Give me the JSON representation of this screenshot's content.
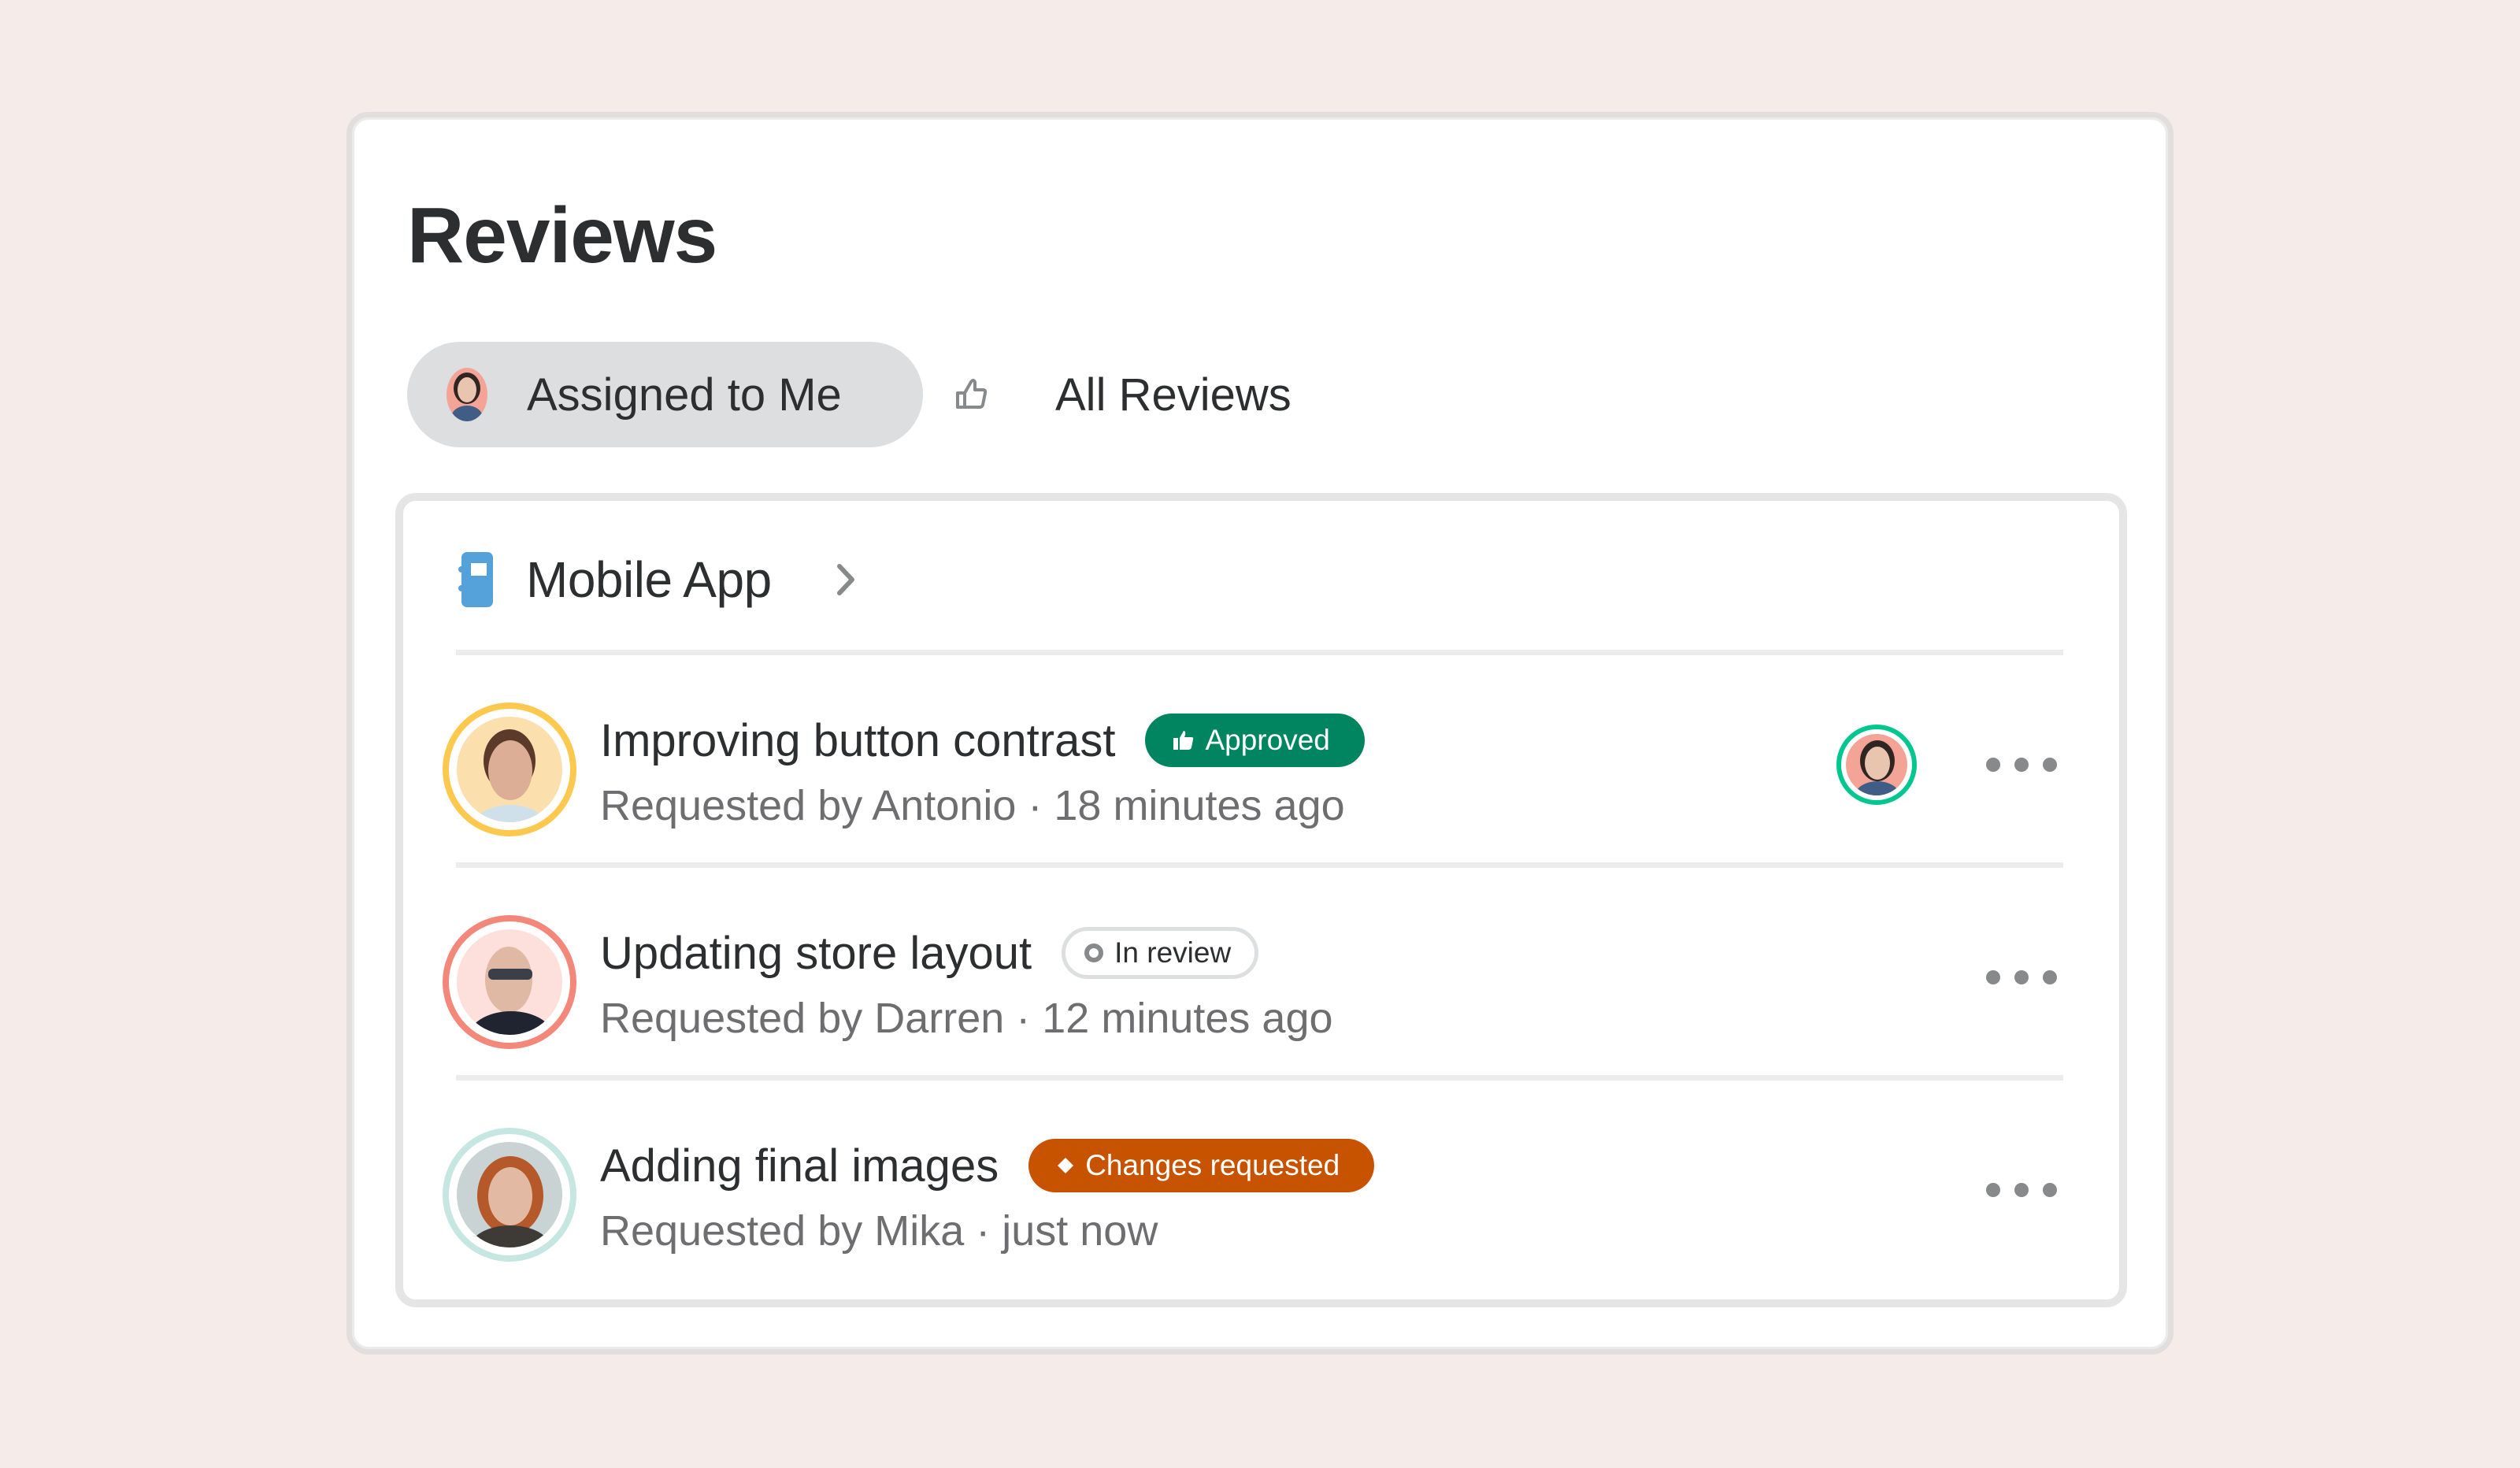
{
  "page": {
    "title": "Reviews",
    "background_color": "#f5ebe8"
  },
  "tabs": [
    {
      "label": "Assigned to Me",
      "icon": "user-avatar",
      "active": true
    },
    {
      "label": "All Reviews",
      "icon": "thumbs-up-outline-icon",
      "active": false
    }
  ],
  "project": {
    "name": "Mobile App",
    "icon": "notebook-icon",
    "icon_color": "#55a2db",
    "chevron": "chevron-right-icon"
  },
  "reviews": [
    {
      "title": "Improving button contrast",
      "status": "Approved",
      "status_icon": "thumbs-up-icon",
      "status_color": "#008561",
      "requester": "Antonio",
      "subtitle": "Requested by Antonio · 18 minutes ago",
      "time": "18 minutes ago",
      "avatar_ring_color": "#fdc84e",
      "avatar_bg_color": "#fbe0ad",
      "has_reviewer_avatar": true,
      "reviewer_ring_color": "#00c78f",
      "more_icon": "more-horizontal-icon"
    },
    {
      "title": "Updating store layout",
      "status": "In review",
      "status_icon": "ring-dot-icon",
      "status_color": "#dddee0",
      "requester": "Darren",
      "subtitle": "Requested by Darren · 12 minutes ago",
      "time": "12 minutes ago",
      "avatar_ring_color": "#f3877a",
      "avatar_bg_color": "#fde0dc",
      "has_reviewer_avatar": false,
      "more_icon": "more-horizontal-icon"
    },
    {
      "title": "Adding final images",
      "status": "Changes requested",
      "status_icon": "diamond-icon",
      "status_color": "#c75300",
      "requester": "Mika",
      "subtitle": "Requested by Mika · just now",
      "time": "just now",
      "avatar_ring_color": "#c6e6e1",
      "avatar_bg_color": "#c9d3d3",
      "has_reviewer_avatar": false,
      "more_icon": "more-horizontal-icon"
    }
  ]
}
